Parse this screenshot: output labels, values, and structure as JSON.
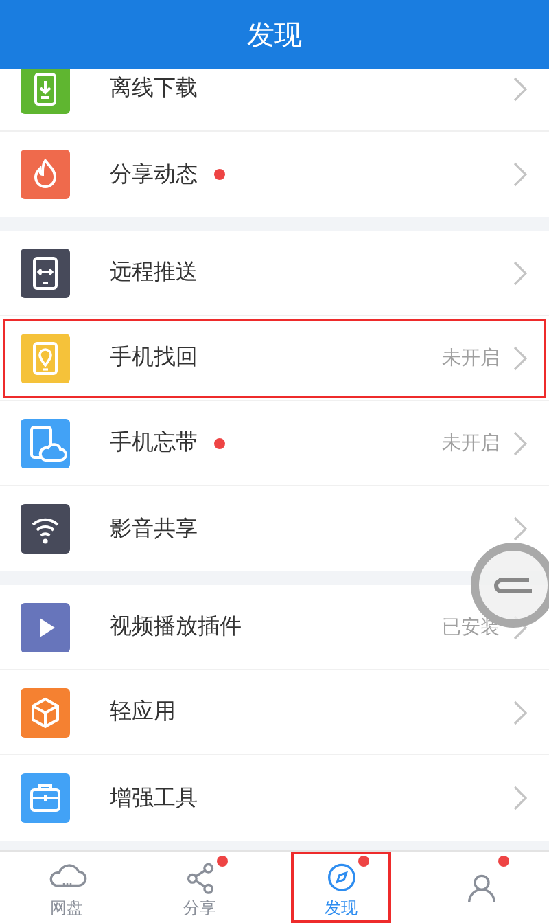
{
  "header": {
    "title": "发现"
  },
  "groups": [
    {
      "items": [
        {
          "label": "离线下载",
          "color": "#5fb630",
          "dot": false,
          "highlighted": false
        },
        {
          "label": "分享动态",
          "color": "#ef6a4c",
          "dot": true,
          "highlighted": false
        }
      ]
    },
    {
      "items": [
        {
          "label": "远程推送",
          "color": "#474a5a",
          "dot": false,
          "highlighted": false
        },
        {
          "label": "手机找回",
          "color": "#f5c23a",
          "dot": false,
          "status": "未开启",
          "highlighted": true
        },
        {
          "label": "手机忘带",
          "color": "#42a2f6",
          "dot": true,
          "status": "未开启",
          "highlighted": false
        },
        {
          "label": "影音共享",
          "color": "#474a5a",
          "dot": false,
          "highlighted": false
        }
      ]
    },
    {
      "items": [
        {
          "label": "视频播放插件",
          "color": "#6775bb",
          "dot": false,
          "status": "已安装",
          "highlighted": false
        },
        {
          "label": "轻应用",
          "color": "#f58131",
          "dot": false,
          "highlighted": false
        },
        {
          "label": "增强工具",
          "color": "#42a2f6",
          "dot": false,
          "highlighted": false
        }
      ]
    }
  ],
  "tabbar": [
    {
      "label": "网盘",
      "selected": false,
      "dot": false,
      "highlighted": false
    },
    {
      "label": "分享",
      "selected": false,
      "dot": true,
      "highlighted": false
    },
    {
      "label": "发现",
      "selected": true,
      "dot": true,
      "highlighted": true
    },
    {
      "selected": false,
      "dot": true,
      "highlighted": false
    }
  ]
}
